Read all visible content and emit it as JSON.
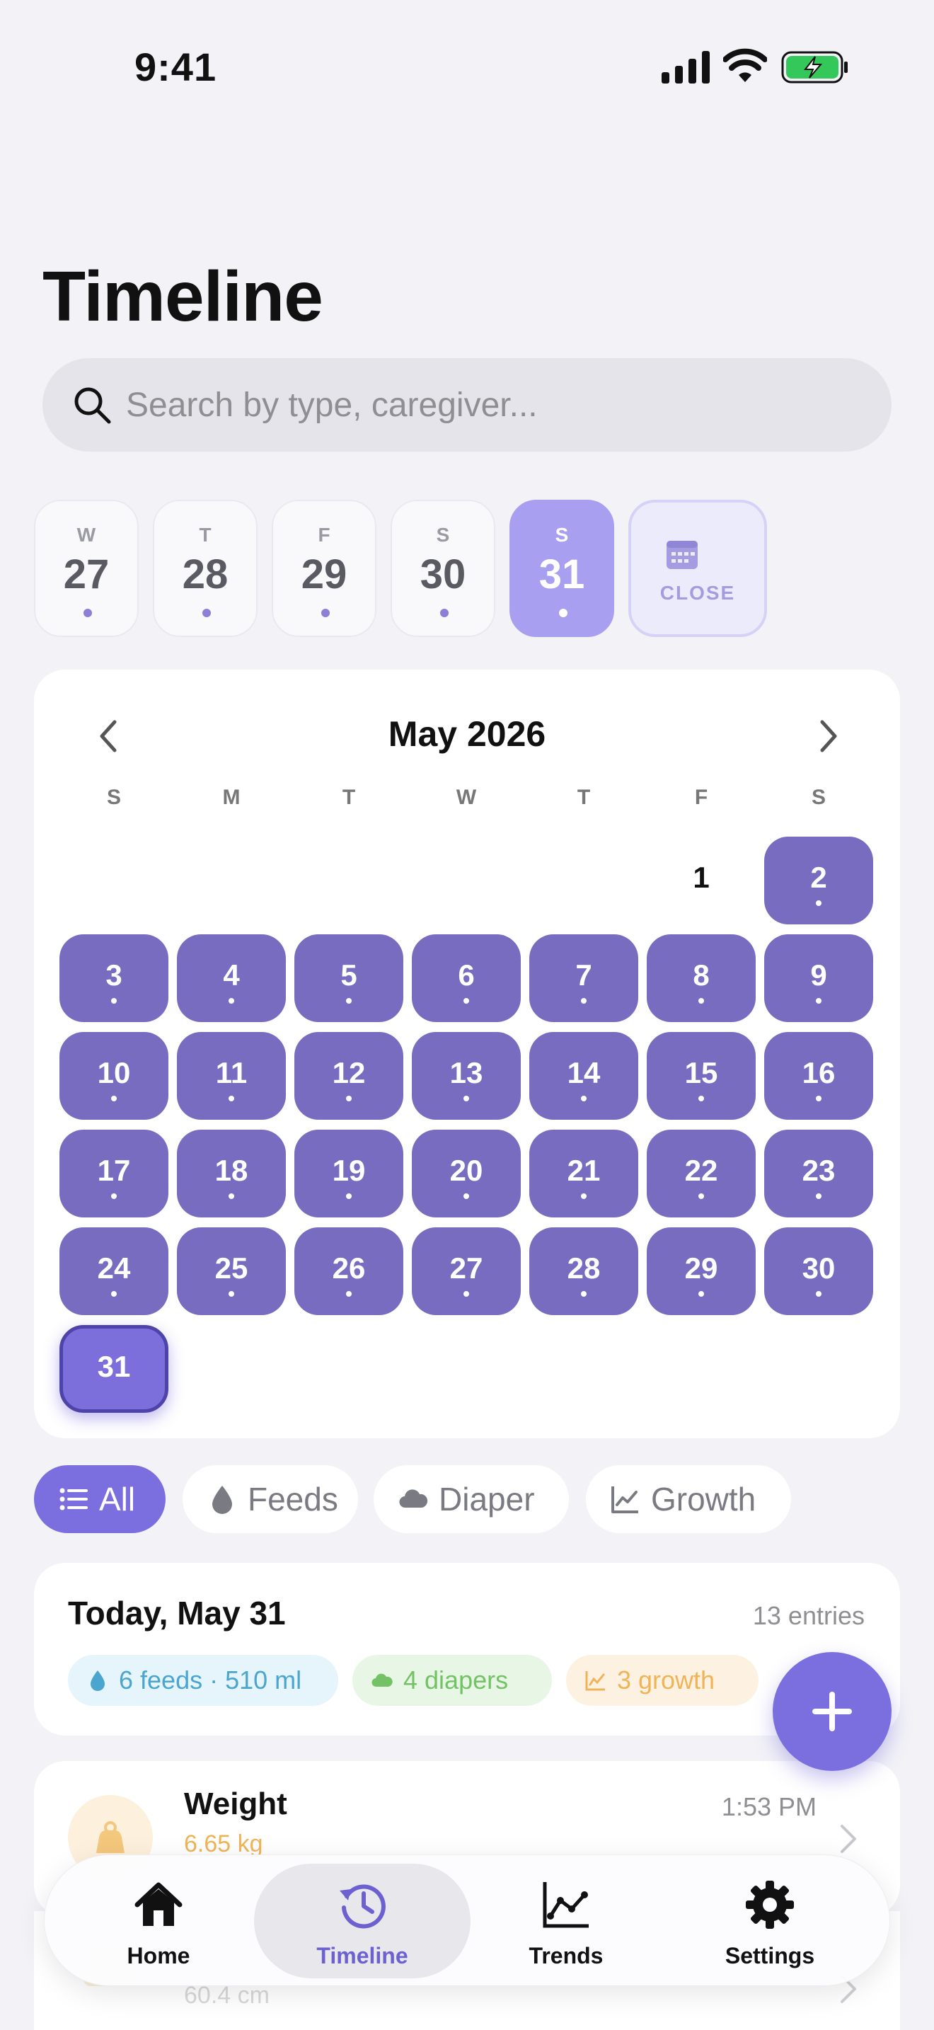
{
  "status_bar": {
    "time": "9:41"
  },
  "page": {
    "title": "Timeline"
  },
  "search": {
    "placeholder": "Search by type, caregiver..."
  },
  "week_strip": {
    "days": [
      {
        "dow": "W",
        "num": "27"
      },
      {
        "dow": "T",
        "num": "28"
      },
      {
        "dow": "F",
        "num": "29"
      },
      {
        "dow": "S",
        "num": "30"
      },
      {
        "dow": "S",
        "num": "31",
        "selected": true
      }
    ],
    "close_label": "CLOSE"
  },
  "calendar": {
    "month_label": "May 2026",
    "weekdays": [
      "S",
      "M",
      "T",
      "W",
      "T",
      "F",
      "S"
    ],
    "first_weekday_index": 5,
    "days_in_month": 31,
    "selected_day": 31,
    "days_with_entries": [
      2,
      3,
      4,
      5,
      6,
      7,
      8,
      9,
      10,
      11,
      12,
      13,
      14,
      15,
      16,
      17,
      18,
      19,
      20,
      21,
      22,
      23,
      24,
      25,
      26,
      27,
      28,
      29,
      30,
      31
    ]
  },
  "filters": [
    {
      "label": "All",
      "icon": "list-icon",
      "active": true
    },
    {
      "label": "Feeds",
      "icon": "drop-icon",
      "active": false
    },
    {
      "label": "Diaper",
      "icon": "cloud-icon",
      "active": false
    },
    {
      "label": "Growth",
      "icon": "chart-line-icon",
      "active": false
    }
  ],
  "summary": {
    "title": "Today, May 31",
    "count": "13 entries",
    "pills": {
      "feeds": "6 feeds · 510 ml",
      "diapers": "4 diapers",
      "growth": "3 growth"
    }
  },
  "entries": [
    {
      "title": "Weight",
      "value": "6.65 kg",
      "time": "1:53 PM",
      "icon": "weight-icon"
    },
    {
      "value": "60.4 cm",
      "icon": "ruler-icon"
    }
  ],
  "tabbar": {
    "home": "Home",
    "timeline": "Timeline",
    "trends": "Trends",
    "settings": "Settings"
  },
  "colors": {
    "accent": "#7b6fe0",
    "day_with_entry": "#786cc0",
    "feeds": "#4aa6cf",
    "diapers": "#74c266",
    "growth": "#f0b458"
  }
}
